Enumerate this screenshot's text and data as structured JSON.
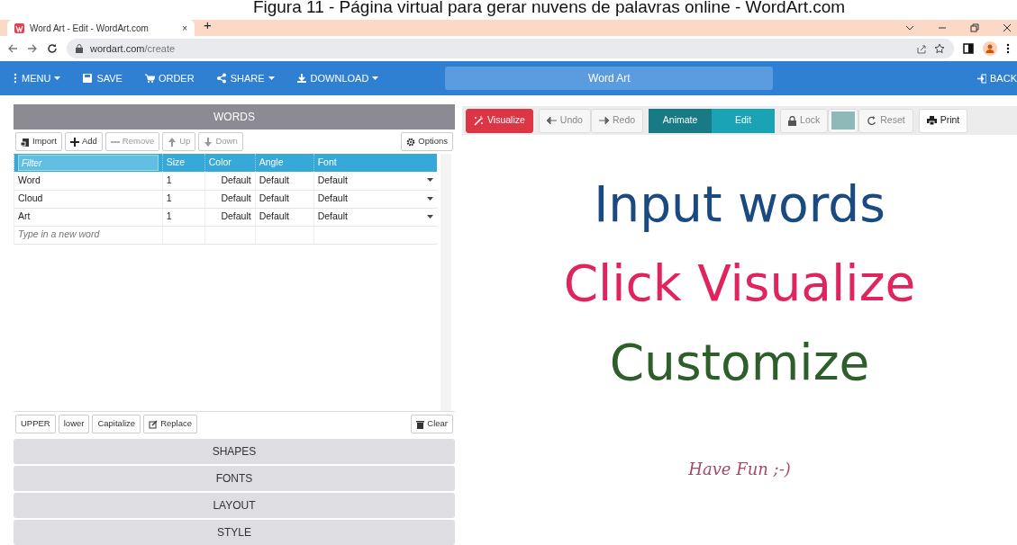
{
  "caption": "Figura 11 - Página virtual para gerar nuvens de palavras online - WordArt.com",
  "browser": {
    "tab_title": "Word Art - Edit - WordArt.com",
    "tab_close": "×",
    "new_tab": "+",
    "url_host": "wordart.com",
    "url_path": "/create"
  },
  "app_nav": {
    "items": [
      {
        "label": "MENU",
        "dropdown": true
      },
      {
        "label": "SAVE",
        "dropdown": false
      },
      {
        "label": "ORDER",
        "dropdown": false
      },
      {
        "label": "SHARE",
        "dropdown": true
      },
      {
        "label": "DOWNLOAD",
        "dropdown": true
      }
    ],
    "title": "Word Art",
    "back": "BACK"
  },
  "words_panel": {
    "title": "WORDS",
    "tools": [
      {
        "label": "Import",
        "disabled": false
      },
      {
        "label": "Add",
        "disabled": false
      },
      {
        "label": "Remove",
        "disabled": true
      },
      {
        "label": "Up",
        "disabled": true
      },
      {
        "label": "Down",
        "disabled": true
      }
    ],
    "options": "Options",
    "columns": [
      {
        "kind": "filter",
        "placeholder": "Filter"
      },
      {
        "kind": "label",
        "label": "Size"
      },
      {
        "kind": "label",
        "label": "Color"
      },
      {
        "kind": "label",
        "label": "Angle"
      },
      {
        "kind": "label",
        "label": "Font"
      }
    ],
    "rows": [
      {
        "cells": [
          "Word",
          "1",
          "Default",
          "Default",
          "Default"
        ]
      },
      {
        "cells": [
          "Cloud",
          "1",
          "Default",
          "Default",
          "Default"
        ]
      },
      {
        "cells": [
          "Art",
          "1",
          "Default",
          "Default",
          "Default"
        ]
      }
    ],
    "new_word_placeholder": "Type in a new word",
    "case_buttons": [
      "UPPER",
      "lower",
      "Capitalize"
    ],
    "replace": "Replace",
    "clear": "Clear"
  },
  "sections": [
    "SHAPES",
    "FONTS",
    "LAYOUT",
    "STYLE"
  ],
  "canvas_toolbar": {
    "visualize": "Visualize",
    "history": [
      {
        "label": "Undo",
        "disabled": true
      },
      {
        "label": "Redo",
        "disabled": true
      }
    ],
    "modes": [
      {
        "label": "Animate",
        "selected": true
      },
      {
        "label": "Edit",
        "selected": false
      }
    ],
    "lock": "Lock",
    "reset": "Reset",
    "print": "Print"
  },
  "canvas_lines": [
    {
      "text": "Input words",
      "kind": "big",
      "color": "#1b4a80"
    },
    {
      "text": "Click Visualize",
      "kind": "big",
      "color": "#e0245e"
    },
    {
      "text": "Customize",
      "kind": "big",
      "color": "#2e5e2a"
    },
    {
      "text": "Have Fun ;-)",
      "kind": "script",
      "color": "#a34a6a"
    }
  ]
}
